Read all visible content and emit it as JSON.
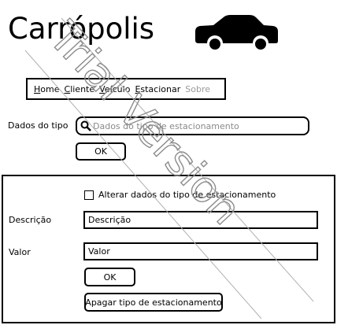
{
  "app": {
    "title": "Carrópolis",
    "logo_icon": "car-icon"
  },
  "nav": {
    "items": [
      {
        "label": "Home",
        "underline": "H",
        "rest": "ome",
        "enabled": true
      },
      {
        "label": "Cliente",
        "underline": "C",
        "rest": "liente",
        "enabled": true
      },
      {
        "label": "Veículo",
        "underline": "V",
        "rest": "eículo",
        "enabled": true
      },
      {
        "label": "Estacionar",
        "underline": "E",
        "rest": "stacionar",
        "enabled": true
      },
      {
        "label": "Sobre",
        "underline": "",
        "rest": "Sobre",
        "enabled": false
      }
    ]
  },
  "search": {
    "label": "Dados do tipo",
    "placeholder": "Dados do tipo de estacionamento",
    "ok_label": "OK"
  },
  "panel": {
    "checkbox_label": "Alterar dados do tipo de estacionamento",
    "checkbox_checked": false,
    "descricao_label": "Descrição",
    "descricao_value": "Descrição",
    "valor_label": "Valor",
    "valor_value": "Valor",
    "ok_label": "OK",
    "delete_label": "Apagar tipo de estacionamento"
  },
  "watermark": {
    "text": "Trial Version"
  }
}
